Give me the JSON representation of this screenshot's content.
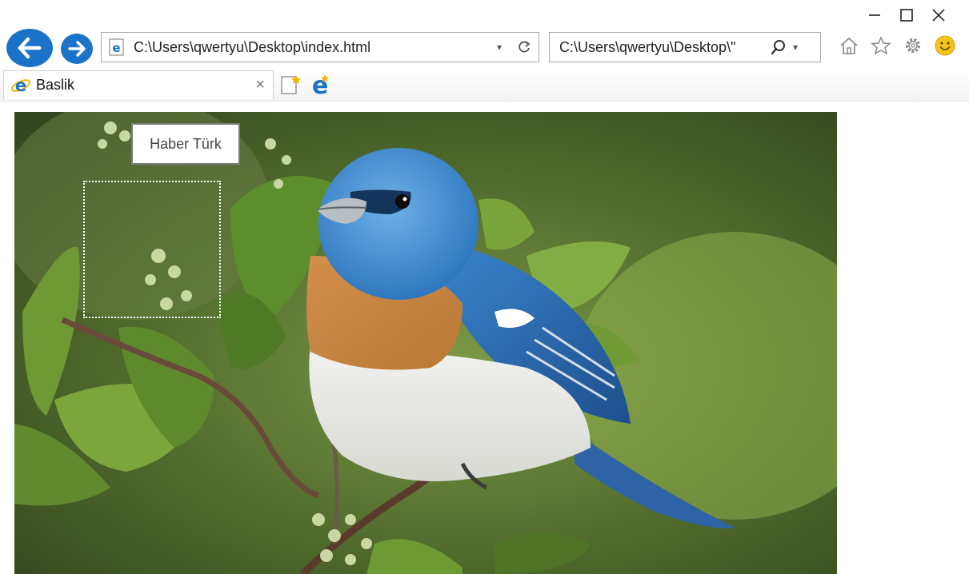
{
  "window": {
    "controls": {
      "minimize": "—",
      "maximize": "☐",
      "close": "✕"
    }
  },
  "toolbar": {
    "address_url": "C:\\Users\\qwertyu\\Desktop\\index.html",
    "search_query": "C:\\Users\\qwertyu\\Desktop\\\"",
    "icons": [
      "back-arrow-icon",
      "forward-arrow-icon",
      "ie-page-icon",
      "dropdown-icon",
      "refresh-icon",
      "search-icon",
      "home-icon",
      "favorites-star-icon",
      "settings-gear-icon",
      "smiley-feedback-icon"
    ]
  },
  "tabs": [
    {
      "title": "Baslik",
      "close": "×"
    }
  ],
  "content": {
    "image_alt": "",
    "tooltip_text": "Haber Türk"
  },
  "colors": {
    "accent_blue": "#1a73c9",
    "smiley_yellow": "#f6c31a"
  }
}
